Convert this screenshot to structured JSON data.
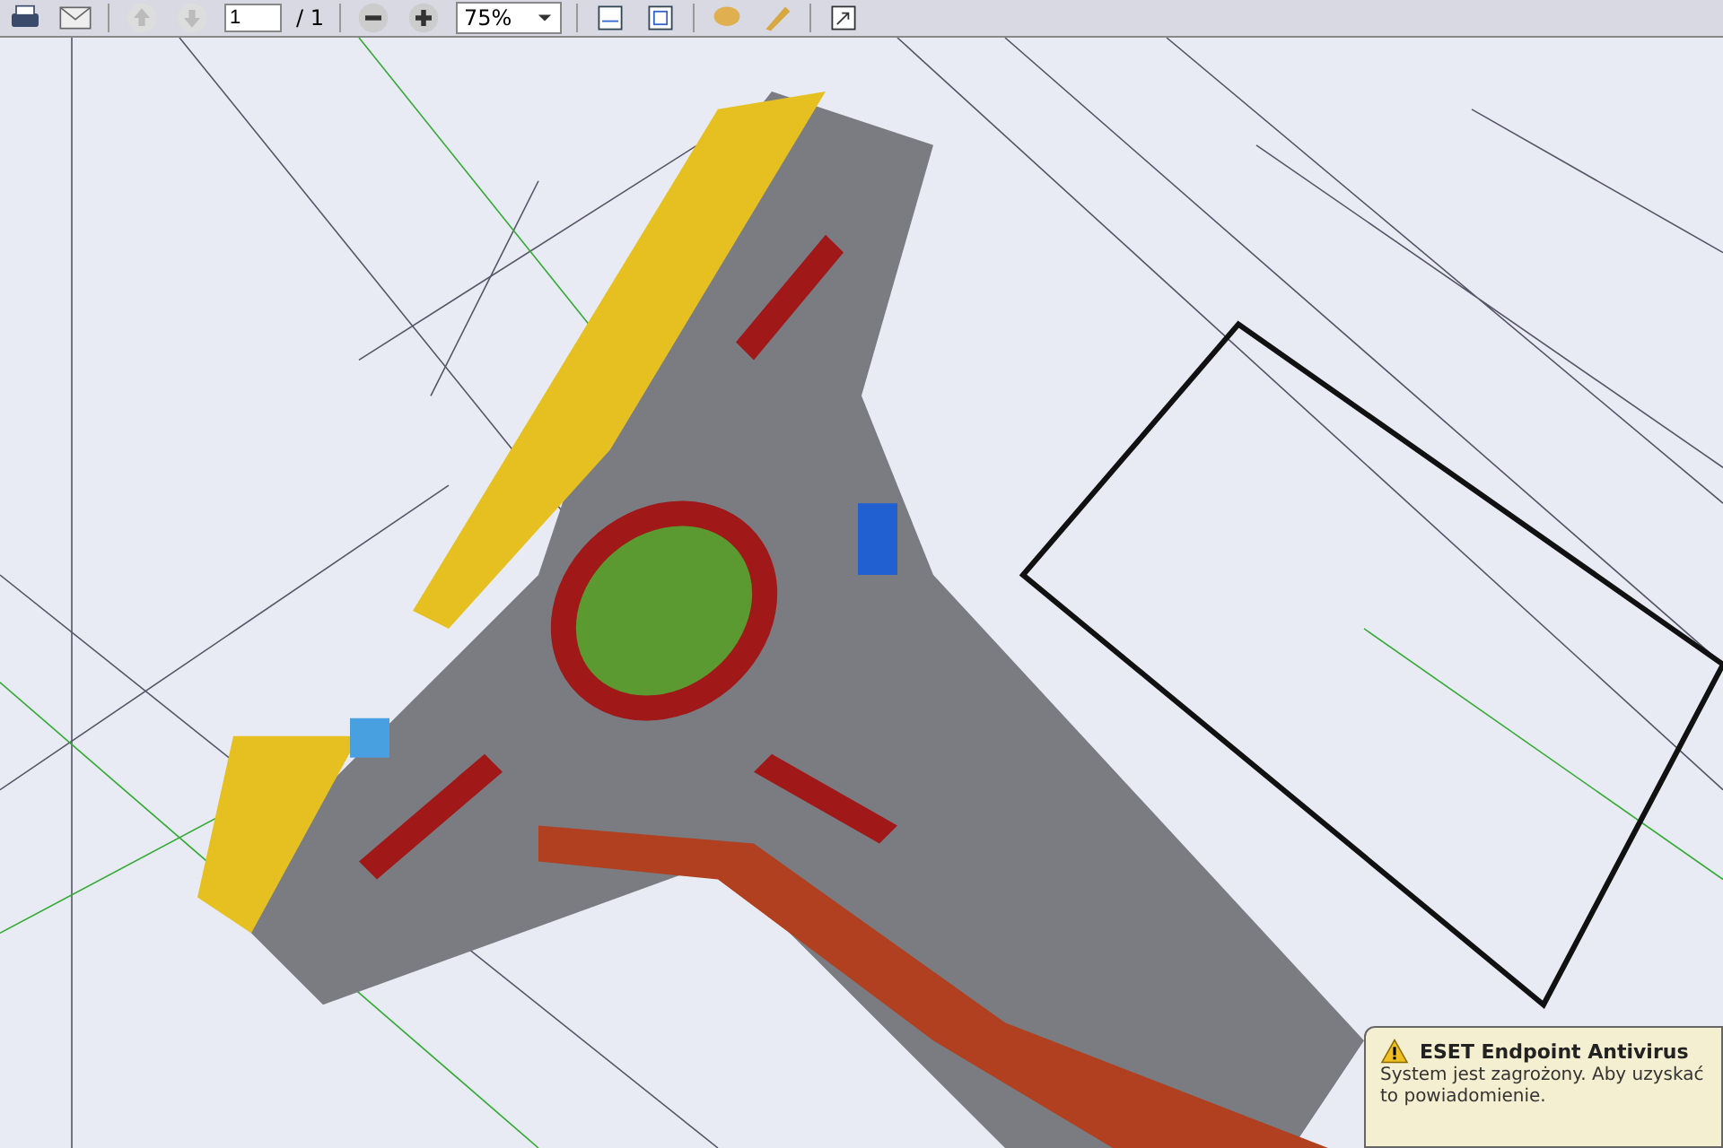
{
  "toolbar": {
    "page_value": "1",
    "page_total": "/ 1",
    "zoom_value": "75%"
  },
  "notification": {
    "title": "ESET Endpoint Antivirus",
    "lines": [
      "System jest zagrożony. Aby uzyskać",
      "to powiadomienie."
    ]
  }
}
